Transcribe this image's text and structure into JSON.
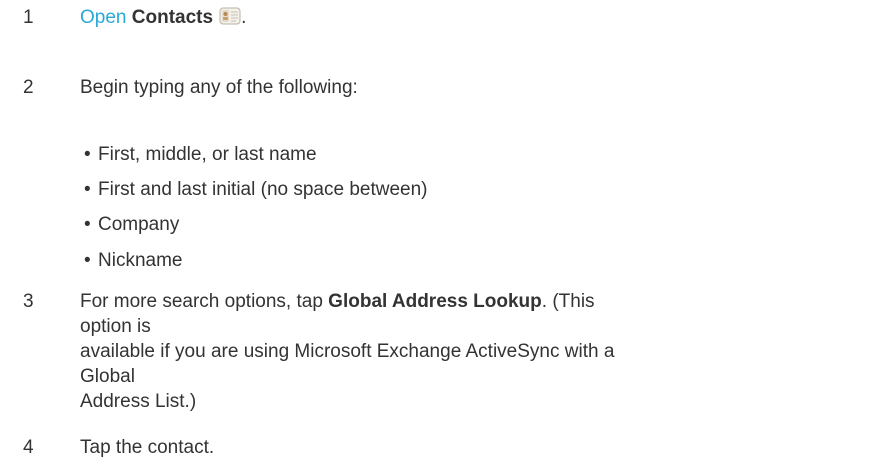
{
  "steps": [
    {
      "number": "1",
      "link_text": "Open",
      "bold_text": "Contacts",
      "icon": "contacts-app-icon",
      "trailing": "."
    },
    {
      "number": "2",
      "text": "Begin typing any of the following:",
      "bullets": [
        "First, middle, or last name",
        "First and last initial (no space between)",
        "Company",
        "Nickname"
      ]
    },
    {
      "number": "3",
      "text_before": "For more search options, tap ",
      "bold_text": "Global Address Lookup",
      "line1_after": ". (This option is",
      "line2": "available if you are using Microsoft Exchange ActiveSync with a Global",
      "line3": "Address List.)"
    },
    {
      "number": "4",
      "text": "Tap the contact."
    }
  ],
  "colors": {
    "text": "#333333",
    "link": "#2aa9d8",
    "background": "#ffffff"
  }
}
